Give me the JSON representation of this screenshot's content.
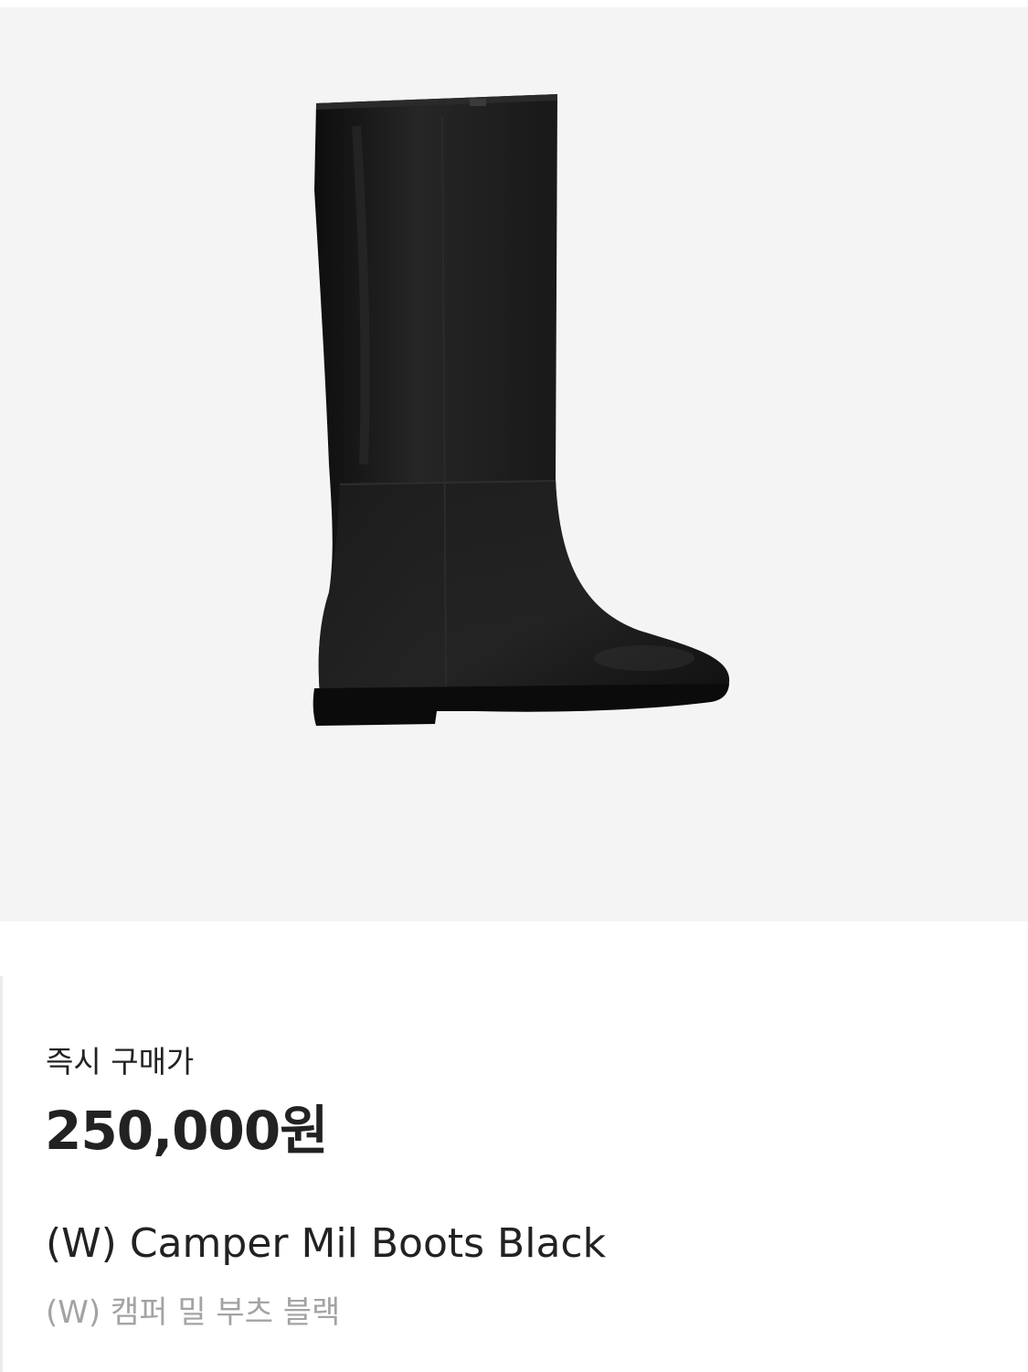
{
  "product": {
    "image_alt": "boot",
    "price_label": "즉시 구매가",
    "price": "250,000원",
    "name_en": "(W) Camper Mil Boots Black",
    "name_ko": "(W) 캠퍼 밀 부츠 블랙"
  },
  "colors": {
    "image_background": "#f4f4f4",
    "text_primary": "#222222",
    "text_secondary": "#a3a3a3",
    "boot": "#161616"
  }
}
